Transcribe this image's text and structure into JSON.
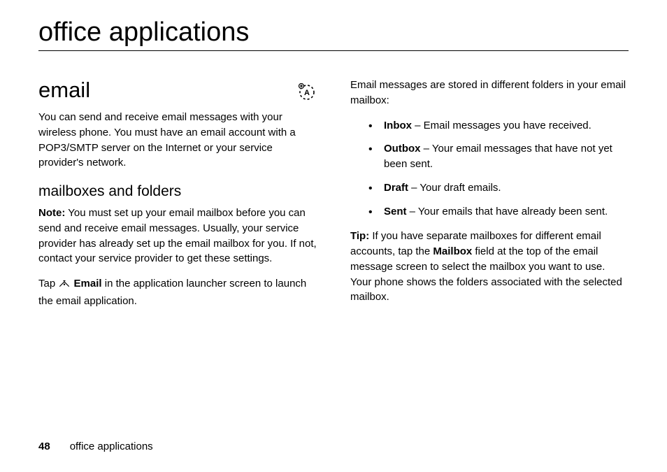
{
  "chapter_title": "office applications",
  "left": {
    "section_title": "email",
    "intro": "You can send and receive email messages with your wireless phone. You must have an email account with a POP3/SMTP server on the Internet or your service provider's network.",
    "subhead": "mailboxes and folders",
    "note_label": "Note:",
    "note_text": " You must set up your email mailbox before you can send and receive email messages. Usually, your service provider has already set up the email mailbox for you. If not, contact your service provider to get these settings.",
    "tap_prefix": "Tap ",
    "tap_icon_label": "Email",
    "tap_suffix": " in the application launcher screen to launch the email application."
  },
  "right": {
    "intro": "Email messages are stored in different folders in your email mailbox:",
    "folders": [
      {
        "name": "Inbox",
        "desc": " – Email messages you have received."
      },
      {
        "name": "Outbox",
        "desc": " – Your email messages that have not yet been sent."
      },
      {
        "name": "Draft",
        "desc": " – Your draft emails."
      },
      {
        "name": "Sent",
        "desc": " – Your emails that have already been sent."
      }
    ],
    "tip_label": "Tip:",
    "tip_before": " If you have separate mailboxes for different email accounts, tap the ",
    "tip_field": "Mailbox",
    "tip_after": " field at the top of the email message screen to select the mailbox you want to use. Your phone shows the folders associated with the selected mailbox."
  },
  "footer": {
    "page_number": "48",
    "running_title": "office applications"
  }
}
